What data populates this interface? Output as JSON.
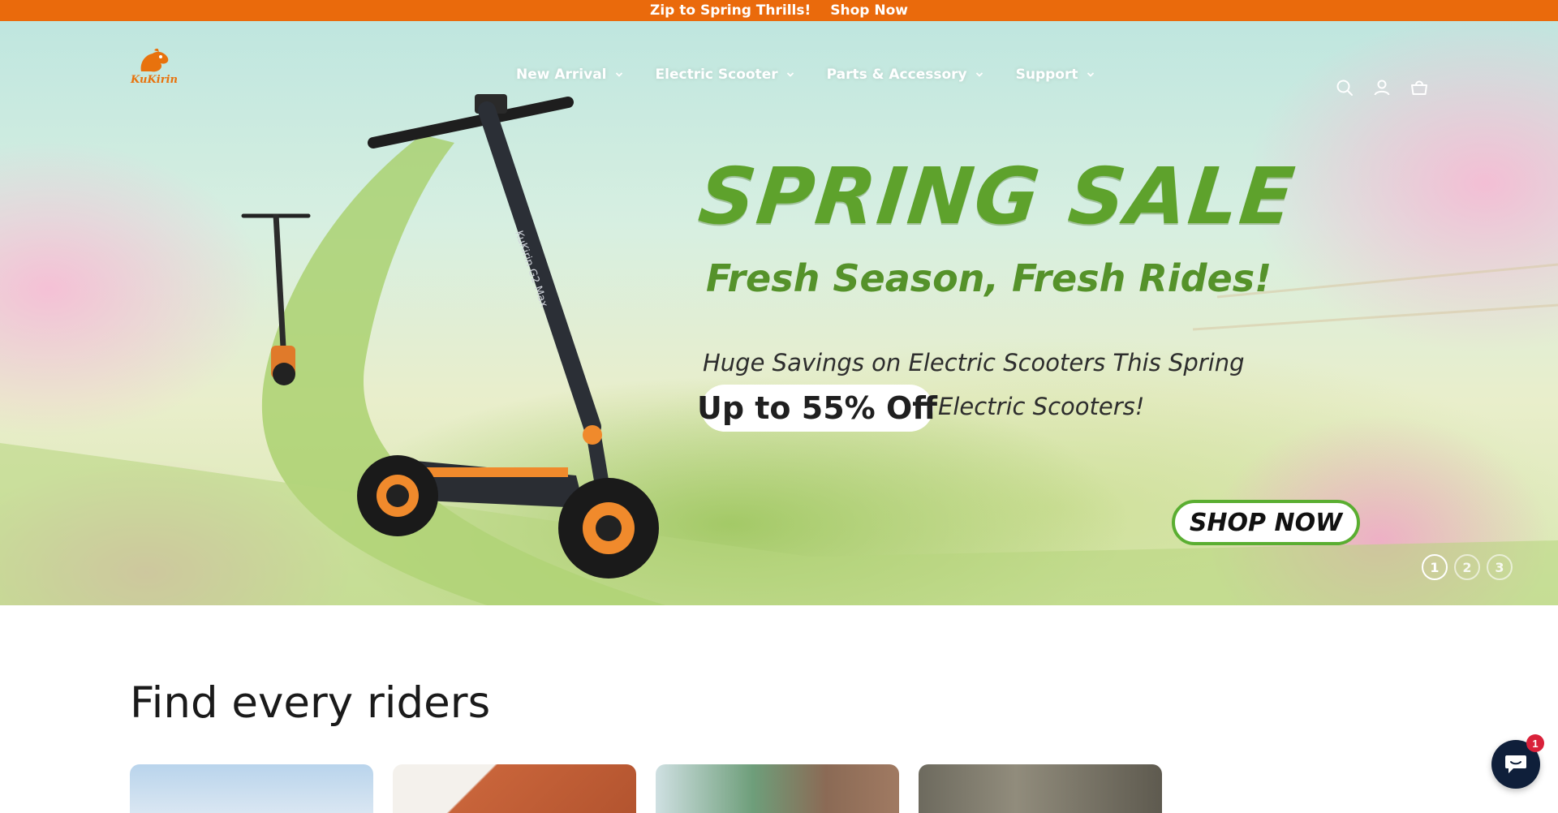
{
  "announcement": {
    "text": "Zip to Spring Thrills!",
    "link": "Shop Now"
  },
  "brand": {
    "logo_text": "KuKirin",
    "accent_color": "#ea6a0c"
  },
  "nav": {
    "items": [
      {
        "label": "New Arrival"
      },
      {
        "label": "Electric Scooter"
      },
      {
        "label": "Parts & Accessory"
      },
      {
        "label": "Support"
      }
    ]
  },
  "header_icons": [
    "search-icon",
    "account-icon",
    "cart-icon"
  ],
  "hero": {
    "title": "SPRING SALE",
    "subtitle": "Fresh Season, Fresh Rides!",
    "savings_line": "Huge Savings on Electric Scooters This Spring",
    "discount": "Up to 55% Off",
    "discount_suffix": "Electric Scooters!",
    "cta": "SHOP NOW",
    "scooter_label": "KuKirin G2 Max",
    "slides": [
      "1",
      "2",
      "3"
    ],
    "active_slide": "1"
  },
  "section": {
    "title": "Find every riders"
  },
  "chat": {
    "badge_count": "1"
  }
}
